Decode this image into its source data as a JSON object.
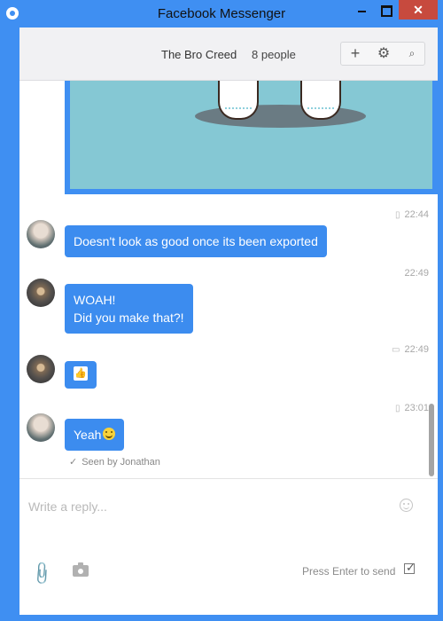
{
  "window": {
    "title": "Facebook Messenger",
    "close_label": "✕",
    "colors": {
      "frame": "#3f8ff2",
      "bubble": "#3c8cef",
      "close": "#c74a3e"
    }
  },
  "header": {
    "title": "The Bro Creed",
    "member_count": "8 people",
    "tools": {
      "add": "+",
      "settings": "⚙",
      "search": "⌕"
    }
  },
  "messages": [
    {
      "time": "22:44",
      "time_icon": "▯",
      "text": "Doesn't look as good once its been exported"
    },
    {
      "time": "22:49",
      "text_line1": "WOAH!",
      "text_line2": "Did you make that?!"
    },
    {
      "time": "22:49",
      "time_icon": "▭",
      "like_icon": "👍"
    },
    {
      "time": "23:01",
      "time_icon": "▯",
      "text": "Yeah"
    }
  ],
  "seen": {
    "check_icon": "✓",
    "text": "Seen by Jonathan"
  },
  "composer": {
    "placeholder": "Write a reply...",
    "send_hint": "Press Enter to send",
    "attach_icon": "📎"
  }
}
